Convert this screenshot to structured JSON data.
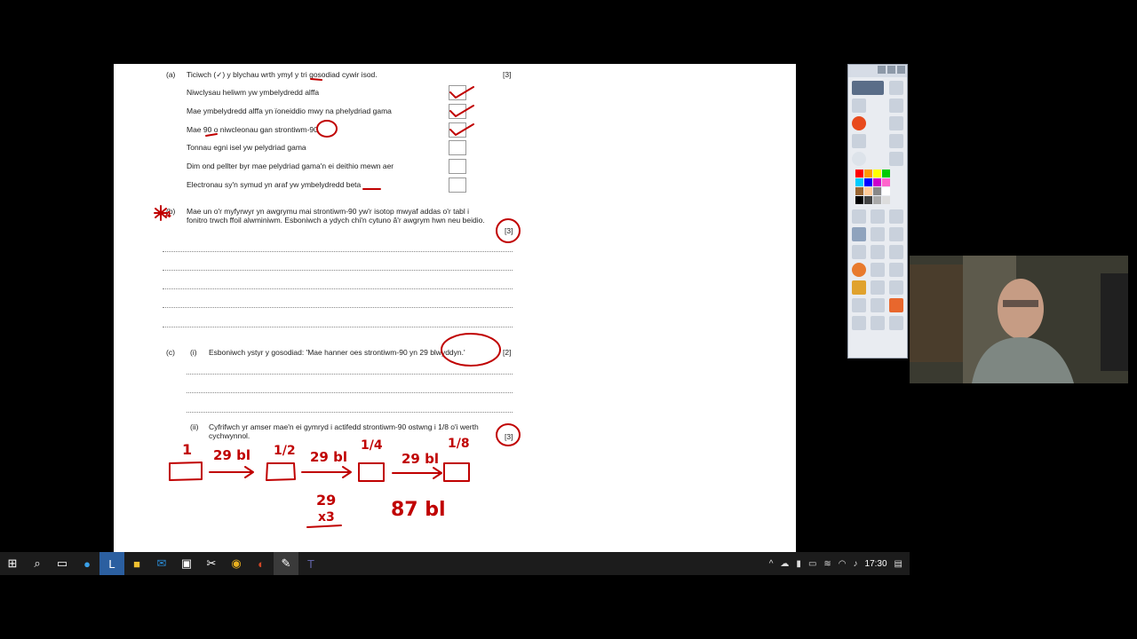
{
  "document": {
    "qa": {
      "label": "(a)",
      "instruction": "Ticiwch (✓) y blychau wrth ymyl y tri gosodiad cywir isod.",
      "marks": "[3]",
      "options": [
        {
          "text": "Niwclysau heliwm yw ymbelydredd alffa",
          "checked": true
        },
        {
          "text": "Mae ymbelydredd alffa yn ïoneiddio mwy na phelydriad gama",
          "checked": true
        },
        {
          "text": "Mae 90 o niwcleonau gan strontiwm-90",
          "checked": true
        },
        {
          "text": "Tonnau egni isel yw pelydriad gama",
          "checked": false
        },
        {
          "text": "Dim ond pellter byr mae pelydriad gama'n ei deithio mewn aer",
          "checked": false
        },
        {
          "text": "Electronau sy'n symud yn araf yw ymbelydredd beta",
          "checked": false
        }
      ]
    },
    "qb": {
      "label": "(b)",
      "line1": "Mae un o'r myfyrwyr yn awgrymu mai strontiwm-90 yw'r isotop mwyaf addas o'r tabl i",
      "line2": "fonitro trwch ffoil alwminiwm. Esboniwch a ydych chi'n cytuno â'r awgrym hwn neu beidio.",
      "marks": "[3]"
    },
    "qc": {
      "label": "(c)",
      "part_i_label": "(i)",
      "part_i_text": "Esboniwch ystyr y gosodiad: 'Mae hanner oes strontiwm-90 yn 29 blwyddyn.'",
      "part_i_marks": "[2]",
      "part_ii_label": "(ii)",
      "part_ii_line1": "Cyfrifwch yr amser mae'n ei gymryd i actifedd strontiwm-90 ostwng i 1/8 o'i werth",
      "part_ii_line2": "cychwynnol.",
      "part_ii_marks": "[3]"
    },
    "handwriting": {
      "star": "4",
      "fractions": [
        "1",
        "1/2",
        "1/4",
        "1/8"
      ],
      "arrows": [
        "29 bl",
        "29 bl",
        "29 bl"
      ],
      "multiplier_top": "29",
      "multiplier_bottom": "x3",
      "answer": "87 bl"
    }
  },
  "taskbar": {
    "icons": [
      "windows-start",
      "search",
      "task-view",
      "edge",
      "l-app",
      "file-explorer",
      "mail",
      "store",
      "capture-tool",
      "chrome",
      "powerpoint",
      "whiteboard-tool",
      "teams"
    ],
    "time": "17:30"
  },
  "colors": {
    "ink": "#c00000",
    "taskbar": "#1c1c1c",
    "background": "#000000"
  }
}
